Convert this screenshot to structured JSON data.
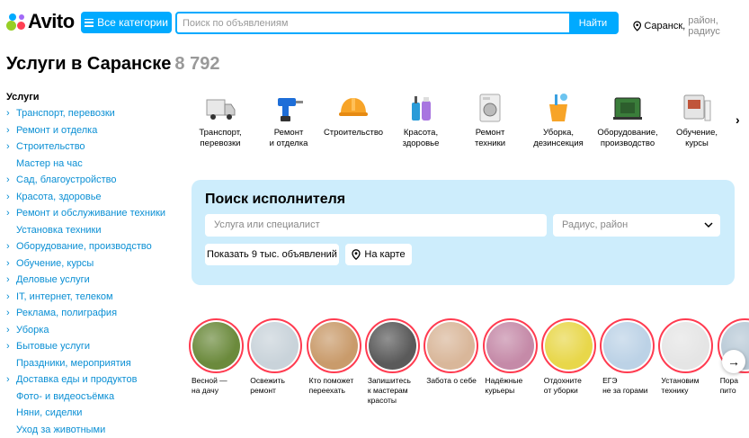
{
  "header": {
    "logo_text": "Avito",
    "categories_label": "Все категории",
    "search_placeholder": "Поиск по объявлениям",
    "search_button": "Найти",
    "location_city": "Саранск,",
    "location_rest": "район, радиус"
  },
  "page": {
    "title": "Услуги в Саранске",
    "count": "8 792"
  },
  "sidebar": {
    "heading": "Услуги",
    "items": [
      {
        "label": "Транспорт, перевозки",
        "chevron": true
      },
      {
        "label": "Ремонт и отделка",
        "chevron": true
      },
      {
        "label": "Строительство",
        "chevron": true
      },
      {
        "label": "Мастер на час",
        "chevron": false
      },
      {
        "label": "Сад, благоустройство",
        "chevron": true
      },
      {
        "label": "Красота, здоровье",
        "chevron": true
      },
      {
        "label": "Ремонт и обслуживание техники",
        "chevron": true
      },
      {
        "label": "Установка техники",
        "chevron": false
      },
      {
        "label": "Оборудование, производство",
        "chevron": true
      },
      {
        "label": "Обучение, курсы",
        "chevron": true
      },
      {
        "label": "Деловые услуги",
        "chevron": true
      },
      {
        "label": "IT, интернет, телеком",
        "chevron": true
      },
      {
        "label": "Реклама, полиграфия",
        "chevron": true
      },
      {
        "label": "Уборка",
        "chevron": true
      },
      {
        "label": "Бытовые услуги",
        "chevron": true
      },
      {
        "label": "Праздники, мероприятия",
        "chevron": false
      },
      {
        "label": "Доставка еды и продуктов",
        "chevron": true
      },
      {
        "label": "Фото- и видеосъёмка",
        "chevron": false
      },
      {
        "label": "Няни, сиделки",
        "chevron": false
      },
      {
        "label": "Уход за животными",
        "chevron": false
      }
    ]
  },
  "categories": [
    {
      "line1": "Транспорт,",
      "line2": "перевозки",
      "icon": "truck-icon"
    },
    {
      "line1": "Ремонт",
      "line2": "и отделка",
      "icon": "drill-icon"
    },
    {
      "line1": "Строительство",
      "line2": "",
      "icon": "helmet-icon"
    },
    {
      "line1": "Красота,",
      "line2": "здоровье",
      "icon": "cosmetics-icon"
    },
    {
      "line1": "Ремонт",
      "line2": "техники",
      "icon": "washer-icon"
    },
    {
      "line1": "Уборка,",
      "line2": "дезинсекция",
      "icon": "bucket-icon"
    },
    {
      "line1": "Оборудование,",
      "line2": "производство",
      "icon": "generator-icon"
    },
    {
      "line1": "Обучение,",
      "line2": "курсы",
      "icon": "tablet-icon"
    }
  ],
  "performer": {
    "title": "Поиск исполнителя",
    "service_placeholder": "Услуга или специалист",
    "radius_placeholder": "Радиус, район",
    "show_button": "Показать 9 тыс. объявлений",
    "map_button": "На карте"
  },
  "stories": [
    {
      "line1": "Весной —",
      "line2": "на дачу",
      "line3": "",
      "color": "#6b8a3c"
    },
    {
      "line1": "Освежить",
      "line2": "ремонт",
      "line3": "",
      "color": "#c9d3da"
    },
    {
      "line1": "Кто поможет",
      "line2": "переехать",
      "line3": "",
      "color": "#c99b6b"
    },
    {
      "line1": "Запишитесь",
      "line2": "к мастерам",
      "line3": "красоты",
      "color": "#5a5a5a"
    },
    {
      "line1": "Забота о себе",
      "line2": "",
      "line3": "",
      "color": "#d9b79a"
    },
    {
      "line1": "Надёжные",
      "line2": "курьеры",
      "line3": "",
      "color": "#c58aa8"
    },
    {
      "line1": "Отдохните",
      "line2": "от уборки",
      "line3": "",
      "color": "#e8d74a"
    },
    {
      "line1": "ЕГЭ",
      "line2": "не за горами",
      "line3": "",
      "color": "#bcd2e6"
    },
    {
      "line1": "Установим",
      "line2": "технику",
      "line3": "",
      "color": "#e5e5e5"
    },
    {
      "line1": "Пора",
      "line2": "пито",
      "line3": "",
      "color": "#b8c9d6"
    }
  ]
}
